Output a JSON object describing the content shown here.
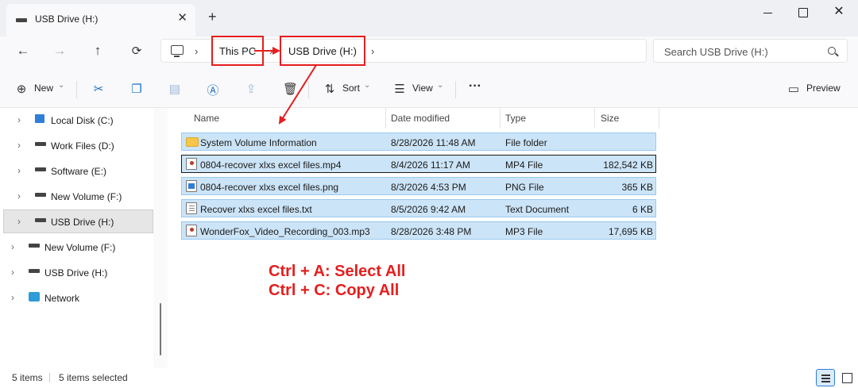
{
  "window": {
    "tab_title": "USB Drive (H:)",
    "new_tab": "+",
    "close_tab": "✕"
  },
  "nav": {
    "back": "←",
    "forward": "→",
    "up": "↑",
    "refresh": "⟳"
  },
  "breadcrumb": {
    "items": [
      "This PC",
      "USB Drive (H:)"
    ],
    "separator": "›"
  },
  "search": {
    "placeholder": "Search USB Drive (H:)"
  },
  "toolbar": {
    "new_label": "New",
    "sort_label": "Sort",
    "view_label": "View",
    "more": "···",
    "preview_label": "Preview"
  },
  "sidebar": {
    "items": [
      {
        "label": "Local Disk (C:)",
        "icon": "windows-drive-icon"
      },
      {
        "label": "Work Files (D:)",
        "icon": "drive-icon"
      },
      {
        "label": "Software (E:)",
        "icon": "drive-icon"
      },
      {
        "label": "New Volume (F:)",
        "icon": "drive-icon"
      },
      {
        "label": "USB Drive (H:)",
        "icon": "drive-icon",
        "selected": true
      },
      {
        "label": "New Volume (F:)",
        "icon": "drive-icon"
      },
      {
        "label": "USB Drive (H:)",
        "icon": "drive-icon"
      },
      {
        "label": "Network",
        "icon": "network-icon"
      }
    ]
  },
  "columns": [
    "Name",
    "Date modified",
    "Type",
    "Size"
  ],
  "files": [
    {
      "name": "System Volume Information",
      "date": "8/28/2026 11:48 AM",
      "type": "File folder",
      "size": "",
      "icon": "folder-icon"
    },
    {
      "name": "0804-recover xlxs excel files.mp4",
      "date": "8/4/2026 11:17 AM",
      "type": "MP4 File",
      "size": "182,542 KB",
      "icon": "video-file-icon"
    },
    {
      "name": "0804-recover xlxs excel files.png",
      "date": "8/3/2026 4:53 PM",
      "type": "PNG File",
      "size": "365 KB",
      "icon": "image-file-icon"
    },
    {
      "name": "Recover xlxs excel files.txt",
      "date": "8/5/2026 9:42 AM",
      "type": "Text Document",
      "size": "6 KB",
      "icon": "text-file-icon"
    },
    {
      "name": "WonderFox_Video_Recording_003.mp3",
      "date": "8/28/2026 3:48 PM",
      "type": "MP3 File",
      "size": "17,695 KB",
      "icon": "audio-file-icon"
    }
  ],
  "annotations": {
    "line1": "Ctrl + A: Select All",
    "line2": "Ctrl + C: Copy All",
    "color": "#e51e1e"
  },
  "status": {
    "item_count": "5 items",
    "selected_count": "5 items selected"
  },
  "colors": {
    "selection": "#cce4f7",
    "accent": "#1a6fc4"
  }
}
